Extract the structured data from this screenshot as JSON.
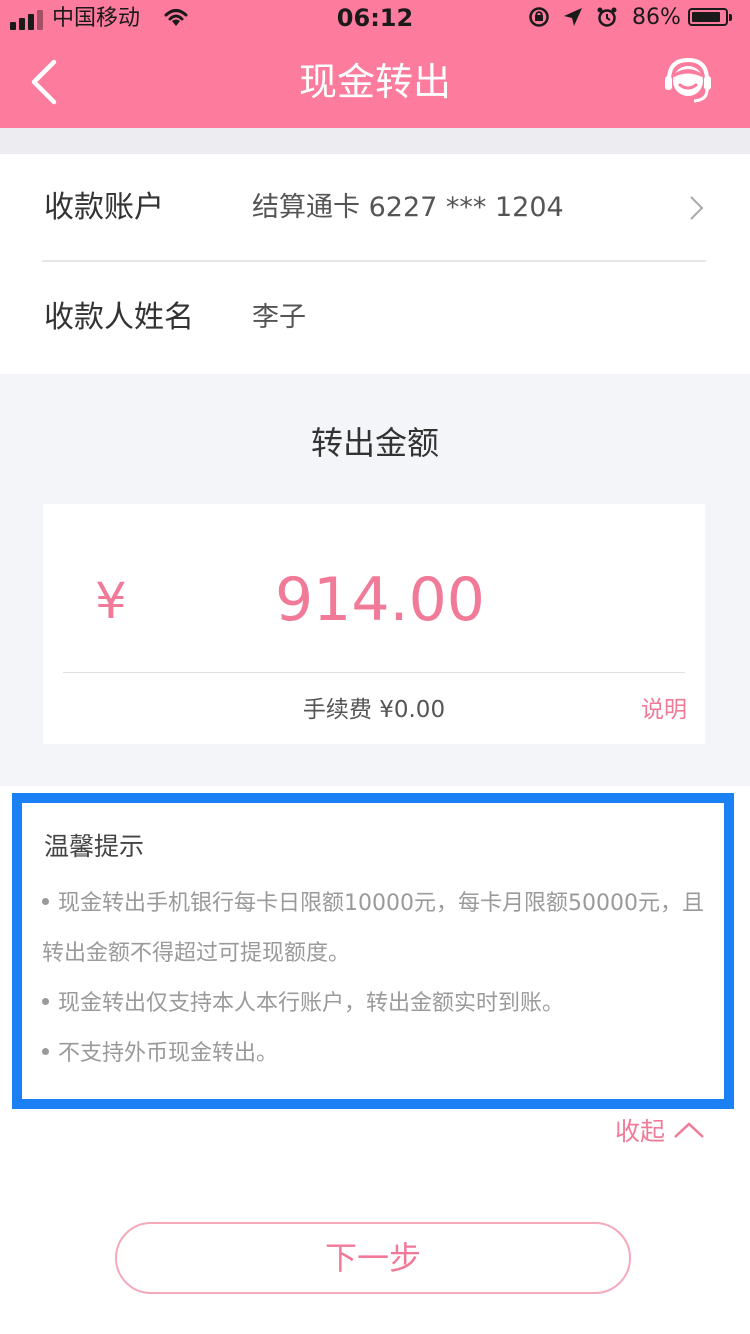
{
  "status_bar": {
    "carrier": "中国移动",
    "time": "06:12",
    "battery": "86%",
    "battery_level": 0.86
  },
  "nav": {
    "title": "现金转出"
  },
  "account": {
    "receiver_account_label": "收款账户",
    "receiver_account_value": "结算通卡  6227 *** 1204",
    "receiver_name_label": "收款人姓名",
    "receiver_name_value": "李子"
  },
  "amount": {
    "title": "转出金额",
    "currency_symbol": "¥",
    "value": "914.00",
    "fee": "手续费 ¥0.00",
    "explain_link": "说明"
  },
  "tips": {
    "title": "温馨提示",
    "items": [
      "现金转出手机银行每卡日限额10000元，每卡月限额50000元，且转出金额不得超过可提现额度。",
      "现金转出仅支持本人本行账户，转出金额实时到账。",
      "不支持外币现金转出。"
    ],
    "collapse_label": "收起"
  },
  "actions": {
    "next_label": "下一步"
  },
  "colors": {
    "header": "#fd7b9c",
    "accent": "#f07a98",
    "highlight_border": "#1a80f4",
    "section_bg": "#f3f5f9"
  }
}
